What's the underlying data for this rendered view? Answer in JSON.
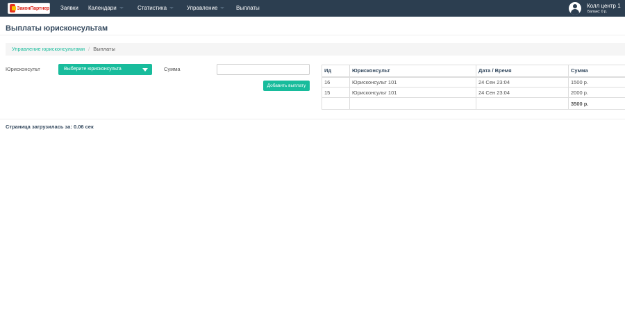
{
  "navbar": {
    "logo_text": "ЗаконПартнер",
    "items": [
      {
        "label": "Заявки",
        "dropdown": false
      },
      {
        "label": "Календари",
        "dropdown": true
      },
      {
        "label": "Статистика",
        "dropdown": true
      },
      {
        "label": "Управление",
        "dropdown": true
      },
      {
        "label": "Выплаты",
        "dropdown": false
      }
    ],
    "user": {
      "name": "Колл центр 1",
      "balance": "Баланс: 0 р."
    }
  },
  "page": {
    "title": "Выплаты юрисконсультам"
  },
  "breadcrumb": {
    "parent": "Управление юрисконсультами",
    "separator": "/",
    "current": "Выплаты"
  },
  "form": {
    "lawyer_label": "Юрисконсульт",
    "lawyer_select": "Выберите юрисконсульта",
    "amount_label": "Сумма",
    "amount_value": "",
    "add_button": "Добавить выплату"
  },
  "table": {
    "columns": [
      "Ид",
      "Юрисконсульт",
      "Дата / Время",
      "Сумма"
    ],
    "rows": [
      {
        "id": "16",
        "lawyer": "Юрисконсульт 101",
        "datetime": "24 Сен 23:04",
        "amount": "1500 р."
      },
      {
        "id": "15",
        "lawyer": "Юрисконсульт 101",
        "datetime": "24 Сен 23:04",
        "amount": "2000 р."
      }
    ],
    "total": "3500 р."
  },
  "footer": {
    "load_time": "Страница загрузилась за: 0.06 сек"
  },
  "colors": {
    "navbar": "#2c3e50",
    "accent": "#18bc9c",
    "heading": "#34495e"
  }
}
